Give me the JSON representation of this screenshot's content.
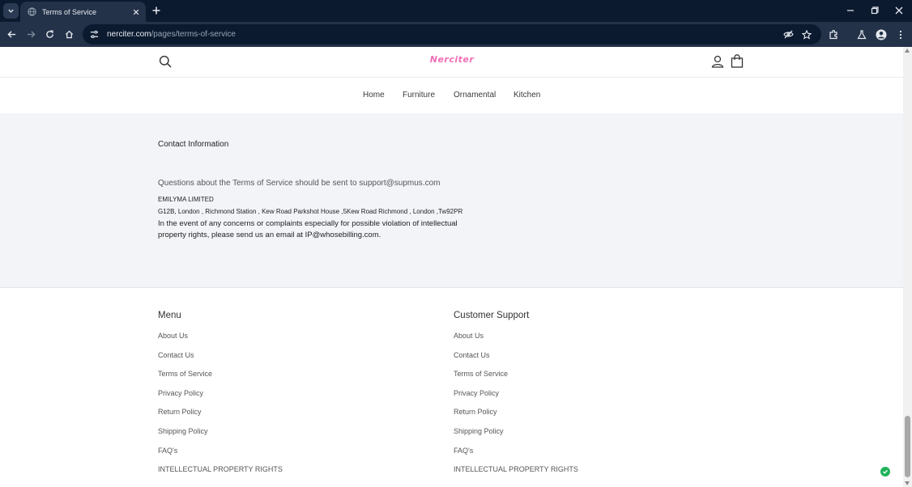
{
  "browser": {
    "tab_title": "Terms of Service",
    "url_host": "nerciter.com",
    "url_path": "/pages/terms-of-service"
  },
  "header": {
    "logo_text": "Nerciter",
    "brand_color": "#f06fb6"
  },
  "nav": {
    "items": [
      "Home",
      "Furniture",
      "Ornamental",
      "Kitchen"
    ]
  },
  "content": {
    "heading": "Contact Information",
    "question": "Questions about the Terms of Service should be sent to support@supmus.com",
    "company": "EMILYMA LIMITED",
    "address": "G12B, London , Richmond Station , Kew Road Parkshot House ,5Kew Road Richmond , London ,Tw92PR",
    "ip_note": "In the event of any concerns or complaints especially for possible violation of intellectual property rights, please send us an email at IP@whosebilling.com."
  },
  "footer": {
    "menu": {
      "heading": "Menu",
      "items": [
        "About Us",
        "Contact Us",
        "Terms of Service",
        "Privacy Policy",
        "Return Policy",
        "Shipping Policy",
        "FAQ's",
        "INTELLECTUAL PROPERTY RIGHTS"
      ]
    },
    "support": {
      "heading": "Customer Support",
      "items": [
        "About Us",
        "Contact Us",
        "Terms of Service",
        "Privacy Policy",
        "Return Policy",
        "Shipping Policy",
        "FAQ's",
        "INTELLECTUAL PROPERTY RIGHTS"
      ]
    }
  },
  "icons": {
    "tab_search": "chevron-down-icon",
    "favicon": "globe-icon",
    "status": "check-circle-icon"
  },
  "colors": {
    "chrome_dark": "#0c1a2f",
    "chrome_toolbar": "#233249",
    "content_bg": "#f3f4f8",
    "status_green": "#1fb35a"
  }
}
